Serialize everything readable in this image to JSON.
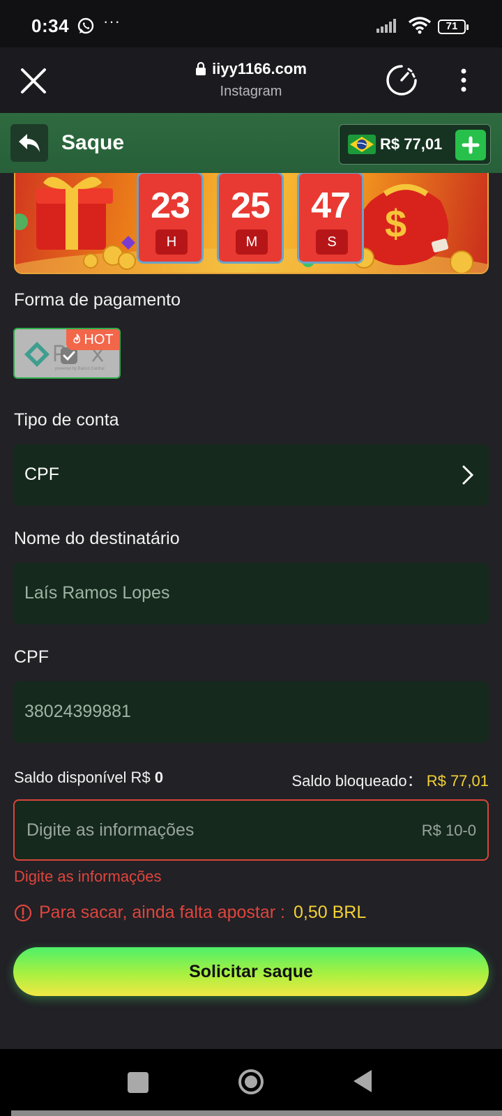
{
  "status_bar": {
    "time": "0:34",
    "more": "···",
    "battery": "71"
  },
  "browser": {
    "url": "iiyy1166.com",
    "source": "Instagram"
  },
  "header": {
    "title": "Saque",
    "balance": "R$ 77,01"
  },
  "countdown": [
    {
      "value": "23",
      "unit": "H"
    },
    {
      "value": "25",
      "unit": "M"
    },
    {
      "value": "47",
      "unit": "S"
    }
  ],
  "payment": {
    "label": "Forma de pagamento",
    "method": "PIX",
    "badge": "HOT"
  },
  "account_type": {
    "label": "Tipo de conta",
    "value": "CPF"
  },
  "recipient": {
    "label": "Nome do destinatário",
    "value": "Laís Ramos Lopes"
  },
  "cpf": {
    "label": "CPF",
    "value": "38024399881"
  },
  "balance": {
    "available_label": "Saldo disponível R$",
    "available_value": "0",
    "blocked_label": "Saldo bloqueado：",
    "blocked_value": "R$ 77,01"
  },
  "amount": {
    "placeholder": "Digite as informações",
    "range": "R$ 10-0",
    "error": "Digite as informações"
  },
  "warning": {
    "text": "Para sacar, ainda falta apostar :",
    "amount": "0,50 BRL"
  },
  "submit_label": "Solicitar saque",
  "colors": {
    "accent_green": "#27c04a",
    "header_green": "#2f6a3f",
    "field_bg": "#15291d",
    "error_red": "#e0453c",
    "highlight_yellow": "#f4d235"
  }
}
